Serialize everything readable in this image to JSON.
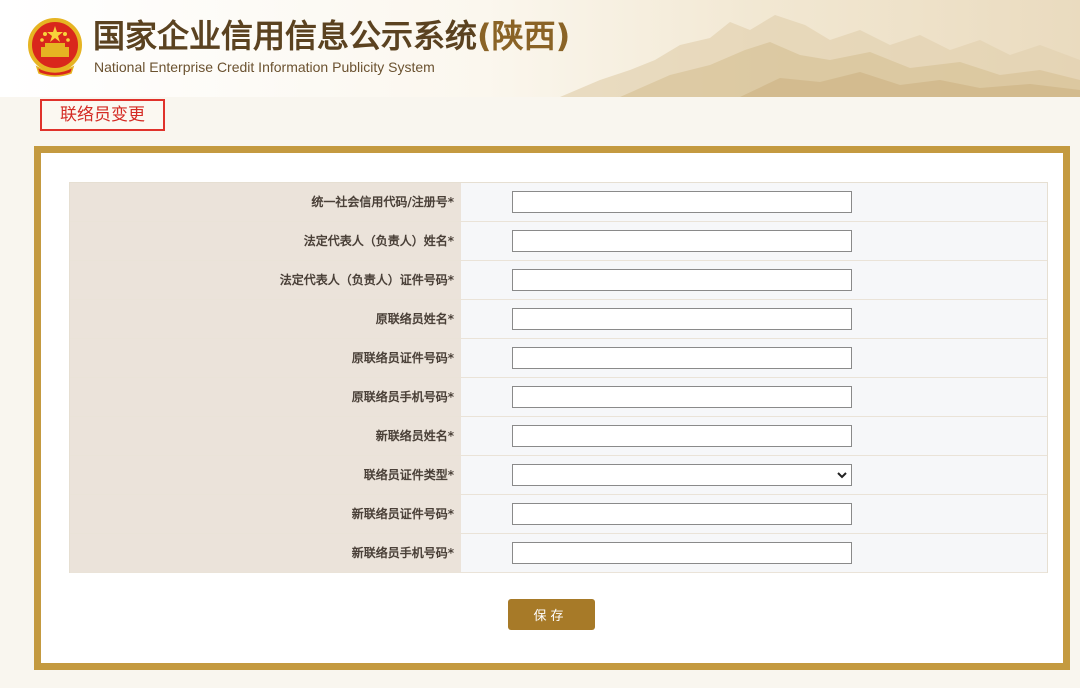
{
  "header": {
    "title_cn": "国家企业信用信息公示系统",
    "title_region": "(陕西)",
    "title_en": "National Enterprise Credit Information Publicity System",
    "emblem_icon": "national-emblem-icon"
  },
  "page": {
    "tab_title": "联络员变更"
  },
  "form": {
    "fields": [
      {
        "label": "统一社会信用代码/注册号*",
        "value": ""
      },
      {
        "label": "法定代表人（负责人）姓名*",
        "value": ""
      },
      {
        "label": "法定代表人（负责人）证件号码*",
        "value": ""
      },
      {
        "label": "原联络员姓名*",
        "value": ""
      },
      {
        "label": "原联络员证件号码*",
        "value": ""
      },
      {
        "label": "原联络员手机号码*",
        "value": ""
      },
      {
        "label": "新联络员姓名*",
        "value": ""
      },
      {
        "label": "联络员证件类型*",
        "value": "",
        "type": "select"
      },
      {
        "label": "新联络员证件号码*",
        "value": ""
      },
      {
        "label": "新联络员手机号码*",
        "value": ""
      }
    ],
    "save_label": "保存"
  },
  "colors": {
    "panel_border": "#c49a40",
    "tab_border": "#e0322b",
    "save_button": "#a77a28",
    "label_bg": "#ebe3da"
  }
}
